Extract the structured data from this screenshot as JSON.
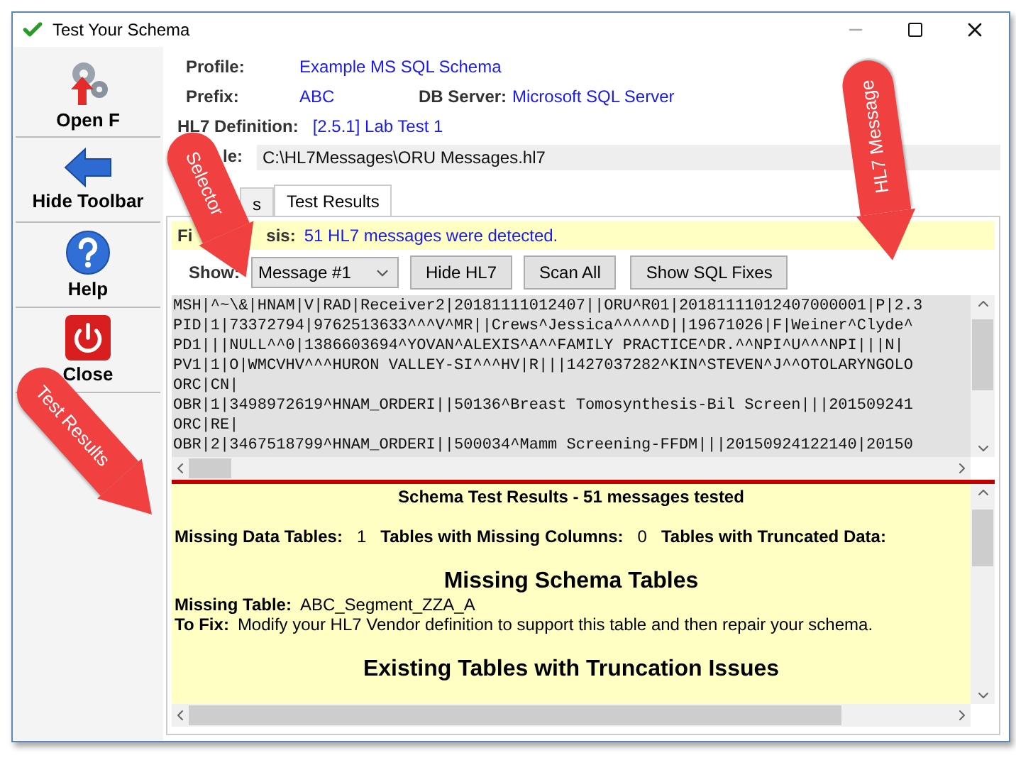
{
  "window": {
    "title": "Test Your Schema"
  },
  "toolbar": {
    "items": [
      {
        "kind": "open",
        "label": "Open F"
      },
      {
        "kind": "hide",
        "label": "Hide Toolbar"
      },
      {
        "kind": "help",
        "label": "Help"
      },
      {
        "kind": "close",
        "label": "Close"
      }
    ]
  },
  "info": {
    "profile": {
      "label": "Profile:",
      "value": "Example MS SQL Schema"
    },
    "prefix": {
      "label": "Prefix:",
      "value": "ABC"
    },
    "db_server": {
      "label": "DB Server:",
      "value": "Microsoft SQL Server"
    },
    "hl7_definition": {
      "label": "HL7 Definition:",
      "value": "[2.5.1] Lab Test 1"
    },
    "file": {
      "label": "le:",
      "value": "C:\\HL7Messages\\ORU Messages.hl7"
    }
  },
  "tabs": [
    {
      "label": "s",
      "selected": false
    },
    {
      "label": "Test Results",
      "selected": true
    }
  ],
  "analysis": {
    "label_start": "Fi",
    "label_end": "sis:",
    "message": "51 HL7 messages were detected."
  },
  "show": {
    "label": "Show:",
    "value": "Message #1"
  },
  "buttons": [
    "Hide HL7",
    "Scan All",
    "Show SQL Fixes"
  ],
  "hl7_lines": [
    "MSH|^~\\&|HNAM|V|RAD|Receiver2|20181111012407||ORU^R01|20181111012407000001|P|2.3",
    "PID|1|73372794|9762513633^^^V^MR||Crews^Jessica^^^^^D||19671026|F|Weiner^Clyde^",
    "PD1|||NULL^^0|1386603694^YOVAN^ALEXIS^A^^FAMILY PRACTICE^DR.^^NPI^U^^^NPI|||N|",
    "PV1|1|O|WMCVHV^^^HURON VALLEY-SI^^^HV|R|||1427037282^KIN^STEVEN^J^^OTOLARYNGOLO",
    "ORC|CN|",
    "OBR|1|3498972619^HNAM_ORDERI||50136^Breast Tomosynthesis-Bil Screen|||201509241",
    "ORC|RE|",
    "OBR|2|3467518799^HNAM_ORDERI||500034^Mamm Screening-FFDM|||20150924122140|20150"
  ],
  "results": {
    "title": "Schema Test Results - 51 messages tested",
    "summary": [
      {
        "label": "Missing Data Tables:",
        "value": "1"
      },
      {
        "label": "Tables with Missing Columns:",
        "value": "0"
      },
      {
        "label": "Tables with Truncated Data:"
      }
    ],
    "sections": [
      {
        "heading": "Missing Schema Tables",
        "fields": [
          {
            "label": "Missing Table:",
            "value": "ABC_Segment_ZZA_A"
          },
          {
            "label": "To Fix:",
            "value": "Modify your HL7 Vendor definition to support this table and then repair your schema."
          }
        ]
      },
      {
        "heading": "Existing Tables with Truncation Issues"
      }
    ]
  },
  "callouts": [
    {
      "kind": "selector",
      "label": "Selector"
    },
    {
      "kind": "message",
      "label": "HL7 Message"
    },
    {
      "kind": "results",
      "label": "Test Results"
    }
  ]
}
